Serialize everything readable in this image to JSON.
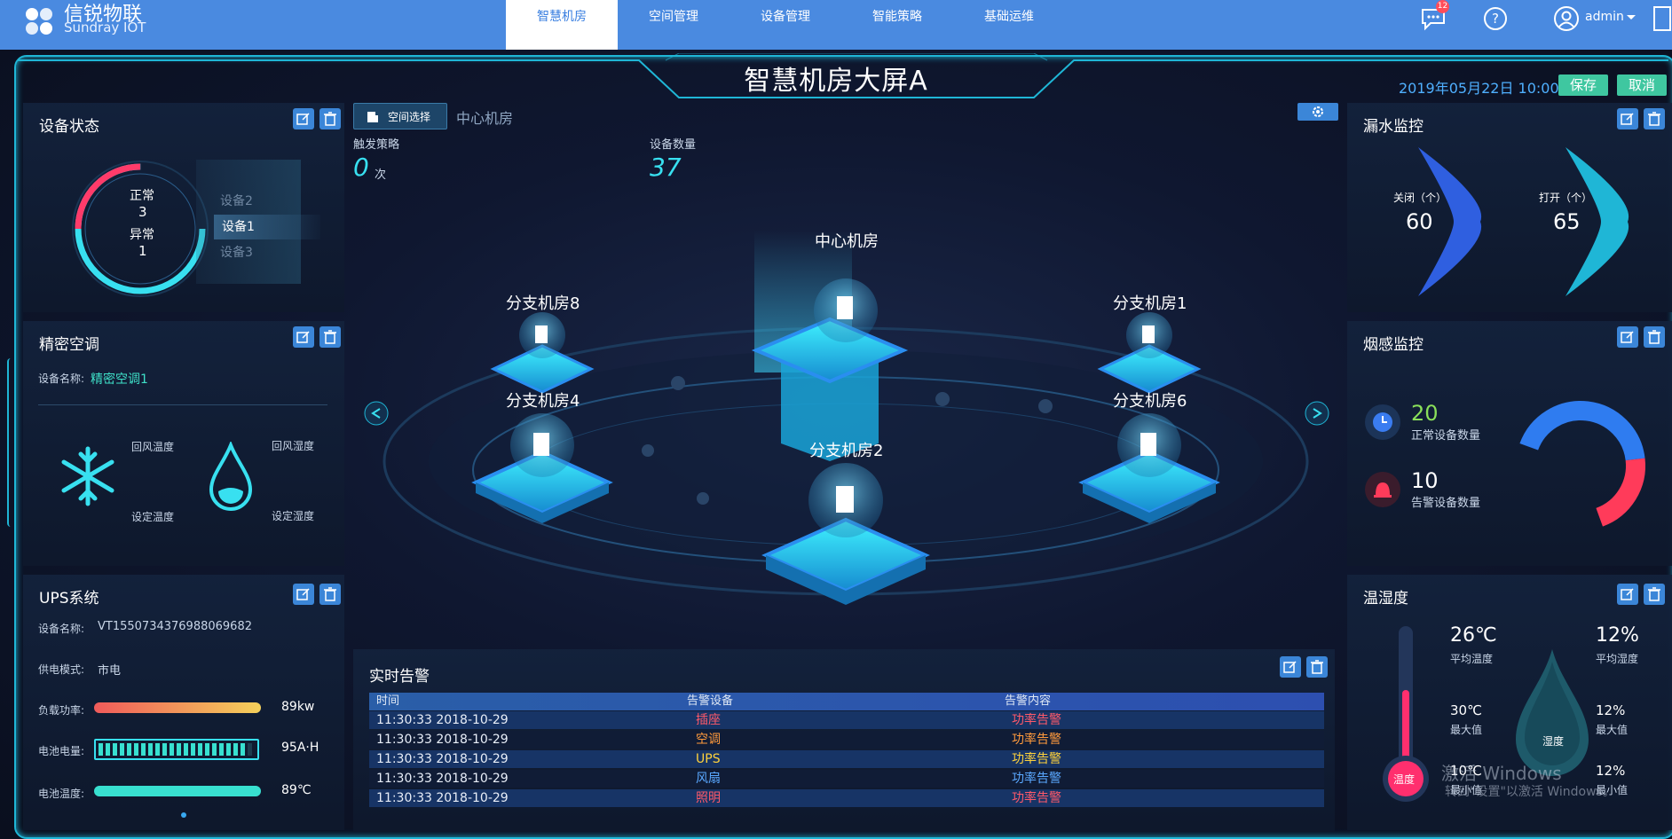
{
  "brand": {
    "name_cn": "信锐物联",
    "name_en": "Sundray IOT"
  },
  "nav": {
    "tabs": [
      {
        "label": "智慧机房",
        "active": true
      },
      {
        "label": "空间管理",
        "active": false
      },
      {
        "label": "设备管理",
        "active": false
      },
      {
        "label": "智能策略",
        "active": false
      },
      {
        "label": "基础运维",
        "active": false
      }
    ],
    "message_count": "12",
    "user": "admin"
  },
  "header": {
    "title": "智慧机房大屏A",
    "datetime": "2019年05月22日  10:00",
    "save_label": "保存",
    "cancel_label": "取消"
  },
  "device_status": {
    "title": "设备状态",
    "normal_label": "正常",
    "normal_count": "3",
    "abnormal_label": "异常",
    "abnormal_count": "1",
    "devices": [
      "设备2",
      "设备1",
      "设备3"
    ],
    "selected": "设备1"
  },
  "aircon": {
    "title": "精密空调",
    "device_name_label": "设备名称:",
    "device_name": "精密空调1",
    "return_temp_label": "回风温度",
    "set_temp_label": "设定温度",
    "return_humidity_label": "回风湿度",
    "set_humidity_label": "设定湿度"
  },
  "ups": {
    "title": "UPS系统",
    "device_name_label": "设备名称:",
    "device_name": "VT1550734376988069682",
    "mode_label": "供电模式:",
    "mode": "市电",
    "load_label": "负载功率:",
    "load_value": "89kw",
    "load_fraction": 1.0,
    "battery_label": "电池电量:",
    "battery_value": "95A·H",
    "battery_fraction": 0.95,
    "battery_temp_label": "电池温度:",
    "battery_temp_value": "89℃",
    "battery_temp_fraction": 1.0
  },
  "center": {
    "space_select_label": "空间选择",
    "space_name": "中心机房",
    "trigger_label": "触发策略",
    "trigger_value": "0",
    "trigger_unit": "次",
    "device_count_label": "设备数量",
    "device_count_value": "37",
    "rooms": {
      "center": "中心机房",
      "b8": "分支机房8",
      "b1": "分支机房1",
      "b4": "分支机房4",
      "b6": "分支机房6",
      "b2": "分支机房2"
    }
  },
  "alarms": {
    "title": "实时告警",
    "headers": [
      "时间",
      "告警设备",
      "告警内容"
    ],
    "rows": [
      {
        "time": "11:30:33 2018-10-29",
        "device": "插座",
        "content": "功率告警",
        "color": "#ff5a6a"
      },
      {
        "time": "11:30:33 2018-10-29",
        "device": "空调",
        "content": "功率告警",
        "color": "#ff9a3c"
      },
      {
        "time": "11:30:33 2018-10-29",
        "device": "UPS",
        "content": "功率告警",
        "color": "#ffd23c"
      },
      {
        "time": "11:30:33 2018-10-29",
        "device": "风扇",
        "content": "功率告警",
        "color": "#5aa8ff"
      },
      {
        "time": "11:30:33 2018-10-29",
        "device": "照明",
        "content": "功率告警",
        "color": "#ff5a6a"
      }
    ]
  },
  "leak": {
    "title": "漏水监控",
    "closed_label": "关闭（个）",
    "closed_value": "60",
    "open_label": "打开（个）",
    "open_value": "65"
  },
  "smoke": {
    "title": "烟感监控",
    "normal_value": "20",
    "normal_label": "正常设备数量",
    "alarm_value": "10",
    "alarm_label": "告警设备数量",
    "normal_fraction": 0.667
  },
  "temp_humidity": {
    "title": "温湿度",
    "avg_temp": "26℃",
    "avg_temp_label": "平均温度",
    "avg_humidity": "12%",
    "avg_humidity_label": "平均湿度",
    "max_temp": "30℃",
    "max_temp_label": "最大值",
    "max_humidity": "12%",
    "max_humidity_label": "最大值",
    "min_temp": "10℃",
    "min_temp_label": "最小值",
    "min_humidity": "12%",
    "min_humidity_label": "最小值",
    "thermo_label": "温度",
    "drop_label": "湿度"
  },
  "watermark": {
    "line1": "激活 Windows",
    "line2": "转到\"设置\"以激活 Windows。"
  },
  "colors": {
    "accent": "#1fb6d6",
    "nav": "#4a8ae0",
    "save": "#3fc7a0",
    "danger": "#ff3b6a"
  }
}
